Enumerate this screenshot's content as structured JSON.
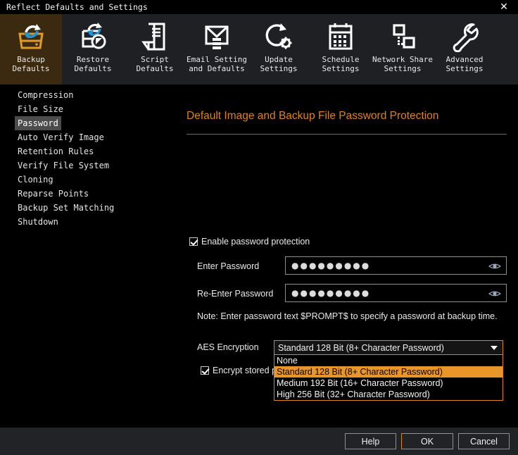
{
  "window": {
    "title": "Reflect Defaults and Settings",
    "close_icon": "close-icon",
    "close_glyph": "✕"
  },
  "toolbar": {
    "items": [
      {
        "line1": "Backup",
        "line2": "Defaults",
        "icon": "backup-defaults-icon",
        "active": true
      },
      {
        "line1": "Restore",
        "line2": "Defaults",
        "icon": "restore-defaults-icon",
        "active": false
      },
      {
        "line1": "Script",
        "line2": "Defaults",
        "icon": "script-defaults-icon",
        "active": false
      },
      {
        "line1": "Email Setting",
        "line2": "and Defaults",
        "icon": "email-settings-icon",
        "active": false
      },
      {
        "line1": "Update",
        "line2": "Settings",
        "icon": "update-settings-icon",
        "active": false
      },
      {
        "line1": "Schedule",
        "line2": "Settings",
        "icon": "schedule-settings-icon",
        "active": false
      },
      {
        "line1": "Network Share",
        "line2": "Settings",
        "icon": "network-share-icon",
        "active": false
      },
      {
        "line1": "Advanced",
        "line2": "Settings",
        "icon": "advanced-settings-icon",
        "active": false
      }
    ]
  },
  "sidebar": {
    "items": [
      {
        "label": "Compression",
        "selected": false
      },
      {
        "label": "File Size",
        "selected": false
      },
      {
        "label": "Password",
        "selected": true
      },
      {
        "label": "Auto Verify Image",
        "selected": false
      },
      {
        "label": "Retention Rules",
        "selected": false
      },
      {
        "label": "Verify File System",
        "selected": false
      },
      {
        "label": "Cloning",
        "selected": false
      },
      {
        "label": "Reparse Points",
        "selected": false
      },
      {
        "label": "Backup Set Matching",
        "selected": false
      },
      {
        "label": "Shutdown",
        "selected": false
      }
    ]
  },
  "main": {
    "title": "Default Image and Backup File Password Protection",
    "enable_password_protection": {
      "label": "Enable password protection",
      "checked": true
    },
    "enter_password": {
      "label": "Enter Password",
      "value": "●●●●●●●●●"
    },
    "reenter_password": {
      "label": "Re-Enter Password",
      "value": "●●●●●●●●●"
    },
    "note": "Note: Enter password text $PROMPT$ to specify a password at backup time.",
    "aes_encryption": {
      "label": "AES Encryption",
      "selected_value": "Standard 128 Bit (8+ Character Password)",
      "expanded": true,
      "options": [
        {
          "label": "None",
          "selected": false
        },
        {
          "label": "Standard 128 Bit (8+ Character Password)",
          "selected": true
        },
        {
          "label": "Medium 192 Bit (16+ Character Password)",
          "selected": false
        },
        {
          "label": "High 256 Bit (32+ Character Password)",
          "selected": false
        }
      ]
    },
    "encrypt_stored_passwords": {
      "label": "Encrypt stored pass",
      "checked": true
    }
  },
  "footer": {
    "help": "Help",
    "ok": "OK",
    "cancel": "Cancel"
  },
  "colors": {
    "accent": "#e08214",
    "highlight": "#e8962a",
    "toolbar_bg": "#1e2023",
    "active_tab_bg": "#3b2a10",
    "bottom_bar_bg": "#212326"
  }
}
